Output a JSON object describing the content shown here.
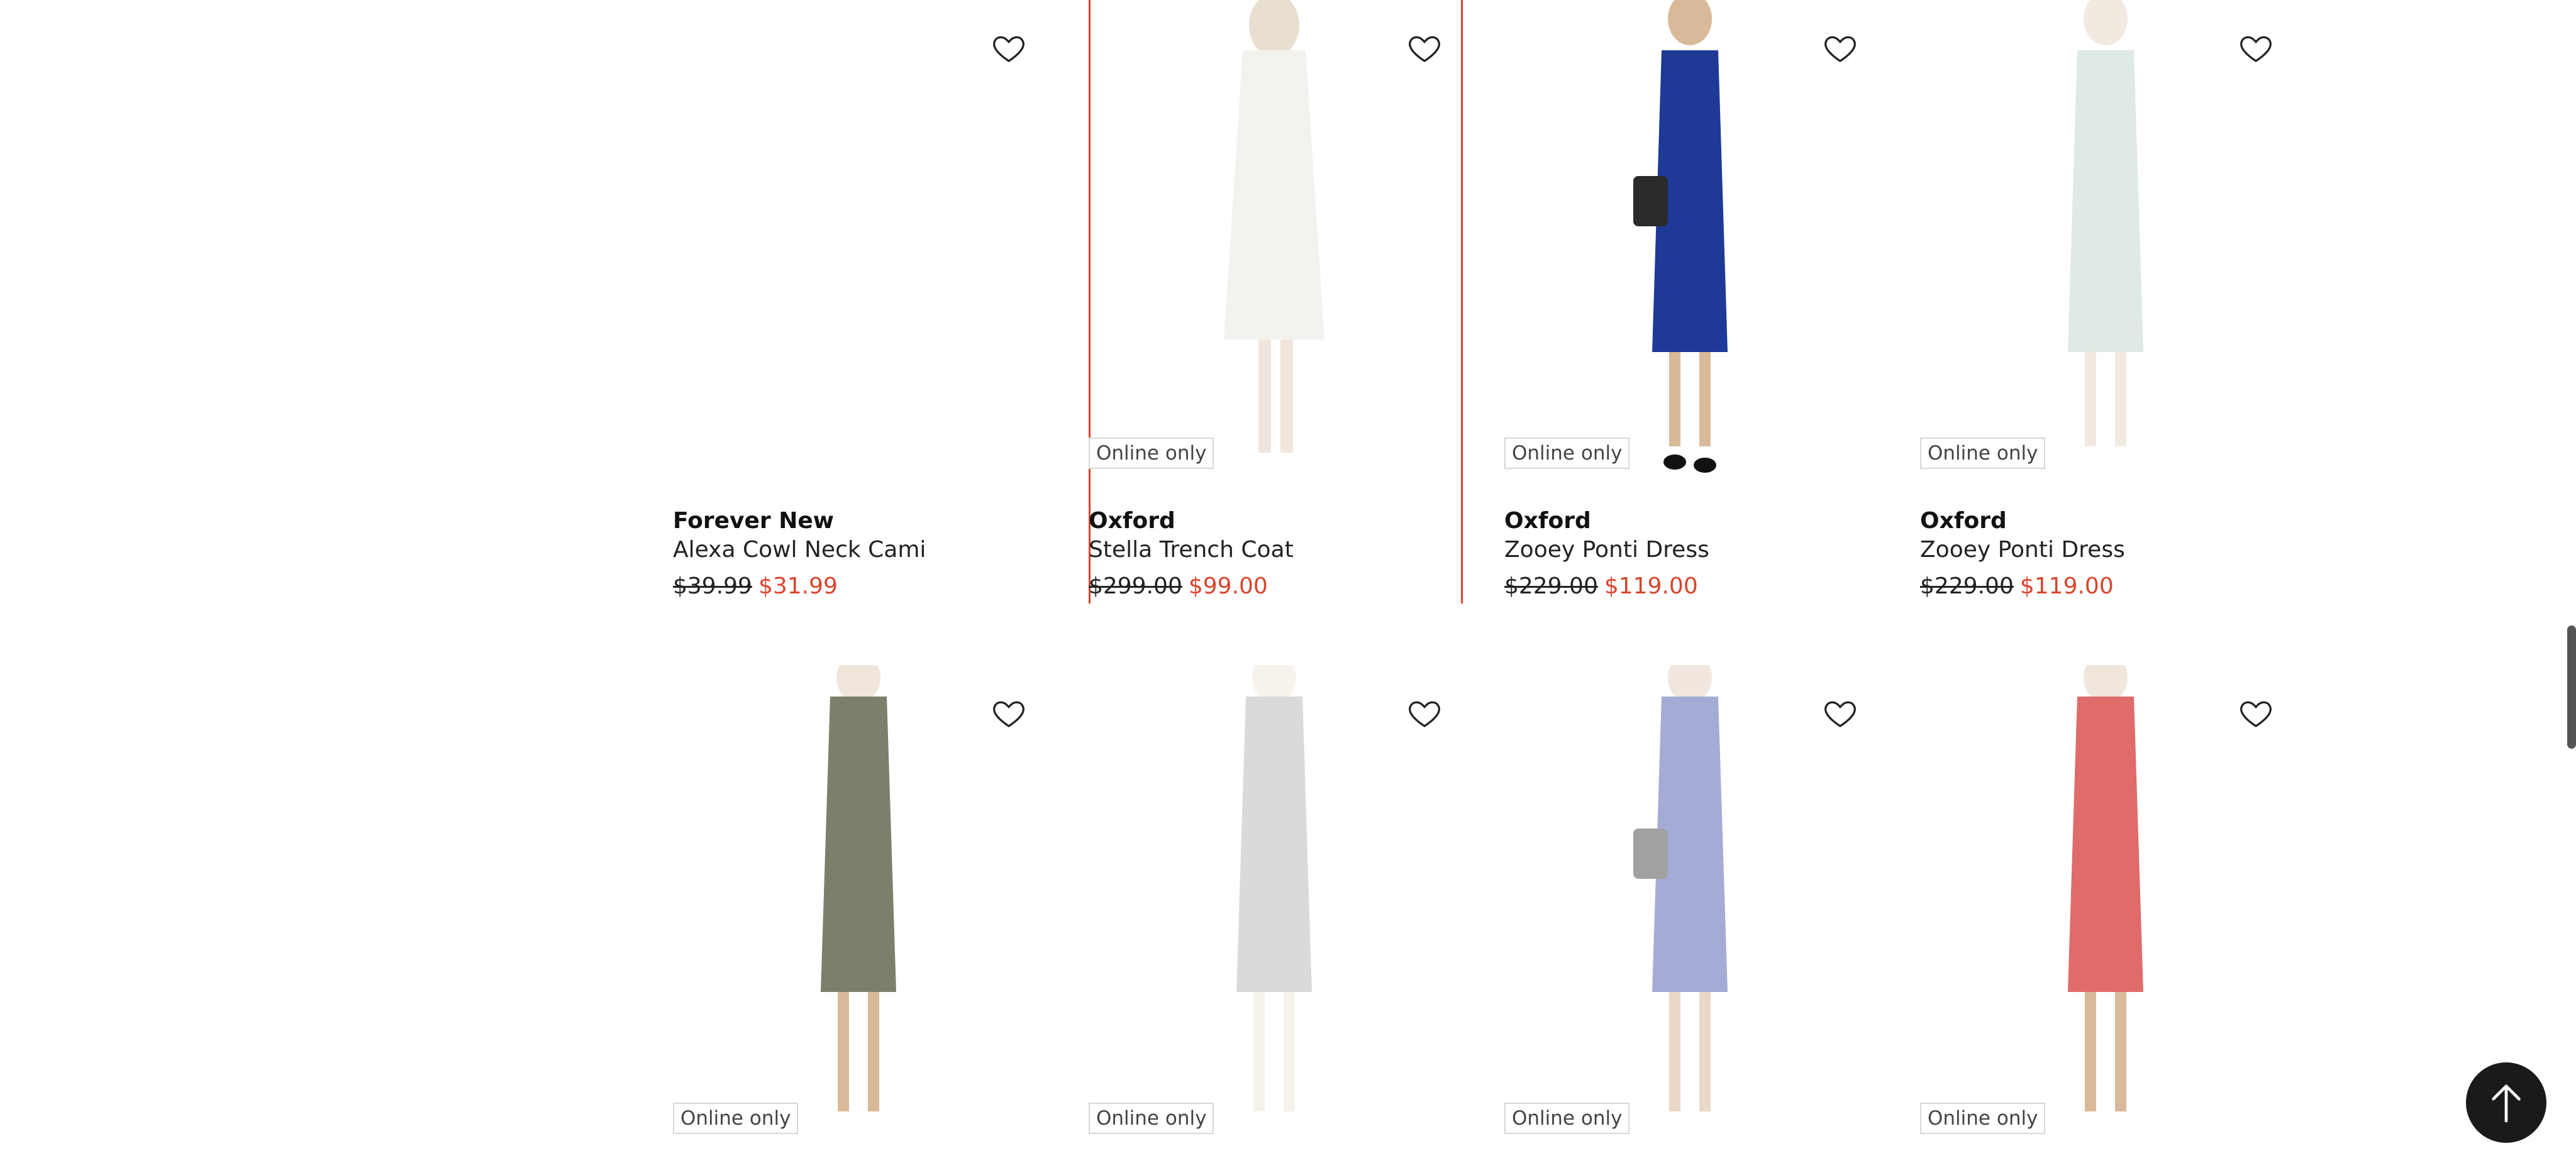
{
  "products": [
    {
      "brand": "Forever New",
      "name": "Alexa Cowl Neck Cami",
      "price_old": "$39.99",
      "price_new": "$31.99",
      "badge": "",
      "color": "#ffffff",
      "faded": false
    },
    {
      "brand": "Oxford",
      "name": "Stella Trench Coat",
      "price_old": "$299.00",
      "price_new": "$99.00",
      "badge": "Online only",
      "color": "#ece9e2",
      "faded": true
    },
    {
      "brand": "Oxford",
      "name": "Zooey Ponti Dress",
      "price_old": "$229.00",
      "price_new": "$119.00",
      "badge": "Online only",
      "color": "#1e3a96",
      "faded": false
    },
    {
      "brand": "Oxford",
      "name": "Zooey Ponti Dress",
      "price_old": "$229.00",
      "price_new": "$119.00",
      "badge": "Online only",
      "color": "#bfd6c9",
      "faded": true
    },
    {
      "brand": "",
      "name": "",
      "price_old": "",
      "price_new": "",
      "badge": "Online only",
      "color": "#7b806c",
      "faded": false
    },
    {
      "brand": "",
      "name": "",
      "price_old": "",
      "price_new": "",
      "badge": "Online only",
      "color": "#3a3a3a",
      "faded": true
    },
    {
      "brand": "",
      "name": "",
      "price_old": "",
      "price_new": "",
      "badge": "Online only",
      "color": "#5a69b3",
      "faded": true
    },
    {
      "brand": "",
      "name": "",
      "price_old": "",
      "price_new": "",
      "badge": "Online only",
      "color": "#e06b6b",
      "faded": false
    }
  ],
  "icons": {
    "favorite": "heart-icon",
    "back_to_top": "arrow-up-icon"
  },
  "colors": {
    "sale": "#d9442c",
    "selected_border": "#d9442c"
  }
}
